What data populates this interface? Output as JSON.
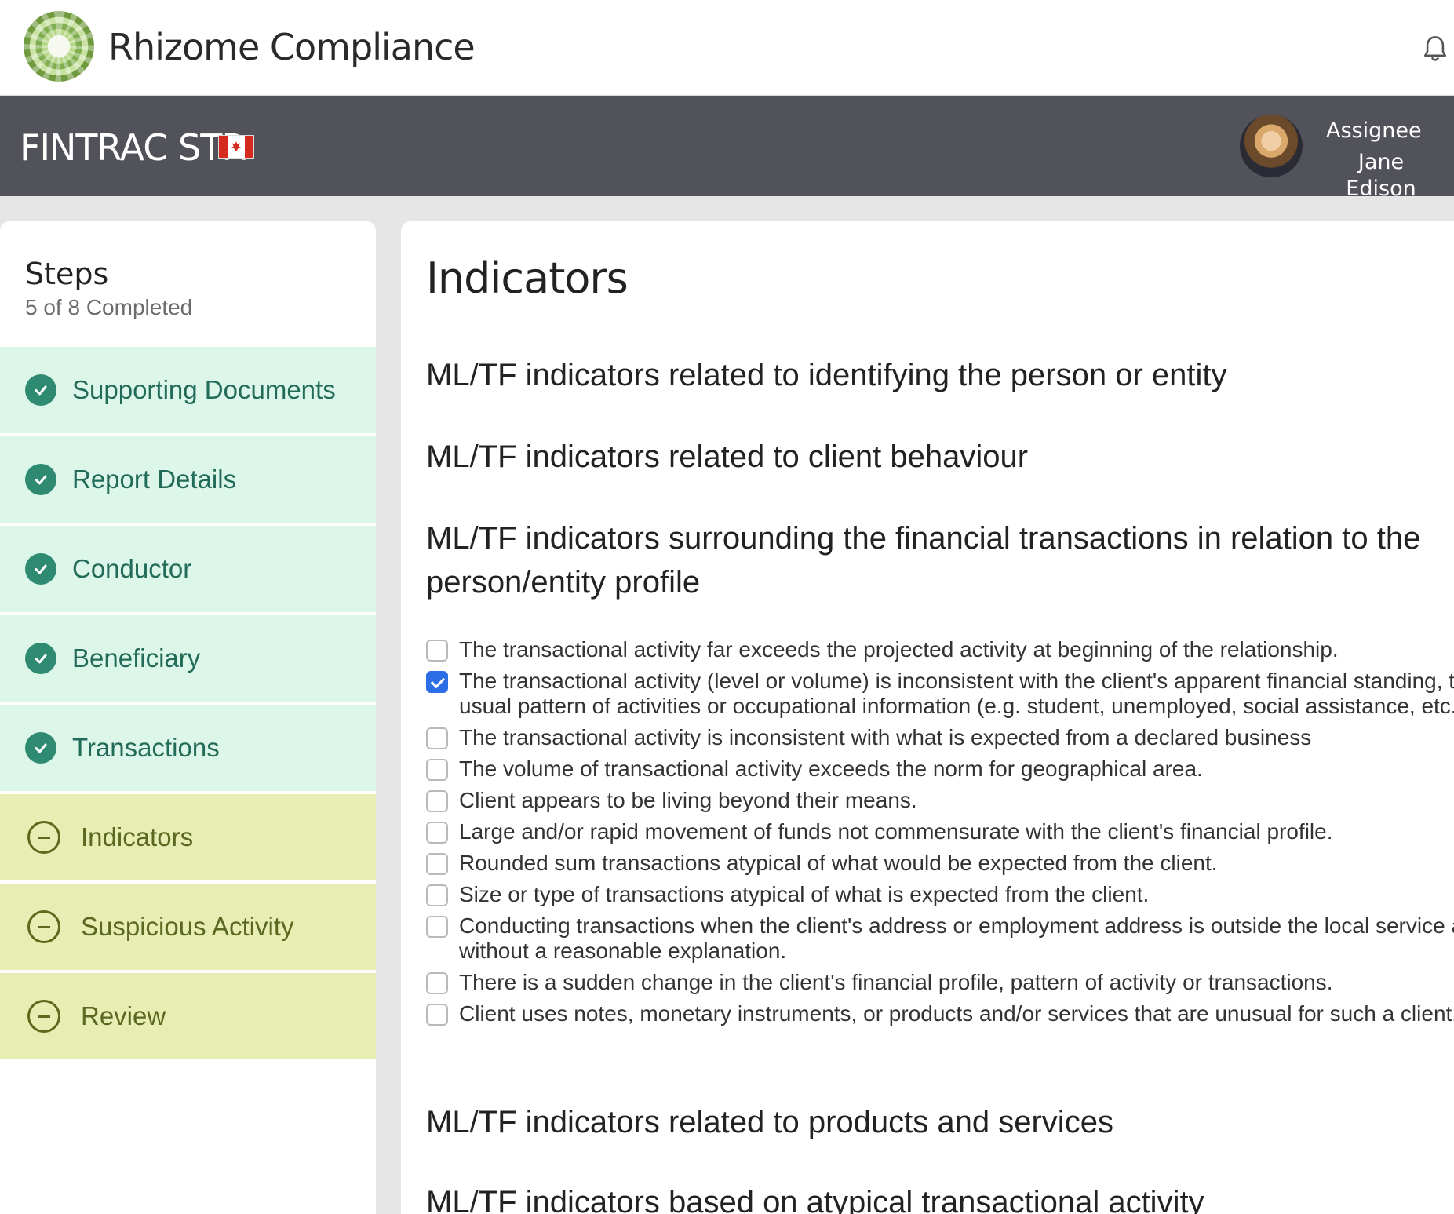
{
  "app": {
    "title": "Rhizome Compliance"
  },
  "header": {
    "form_title": "FINTRAC STR",
    "assignee_label": "Assignee",
    "assignee_name": "Jane Edison"
  },
  "sidebar": {
    "title": "Steps",
    "progress": "5 of 8 Completed",
    "items": [
      {
        "label": "Supporting Documents",
        "status": "completed"
      },
      {
        "label": "Report Details",
        "status": "completed"
      },
      {
        "label": "Conductor",
        "status": "completed"
      },
      {
        "label": "Beneficiary",
        "status": "completed"
      },
      {
        "label": "Transactions",
        "status": "completed"
      },
      {
        "label": "Indicators",
        "status": "pending"
      },
      {
        "label": "Suspicious Activity",
        "status": "pending"
      },
      {
        "label": "Review",
        "status": "pending"
      }
    ]
  },
  "main": {
    "title": "Indicators",
    "sections": [
      "ML/TF indicators related to identifying the person or entity",
      "ML/TF indicators related to client behaviour",
      "ML/TF indicators surrounding the financial transactions in relation to the person/entity profile",
      "ML/TF indicators related to products and services",
      "ML/TF indicators based on atypical transactional activity"
    ],
    "indicators": [
      {
        "text": "The transactional activity far exceeds the projected activity at beginning of the relationship.",
        "checked": false
      },
      {
        "text": "The transactional activity (level or volume) is inconsistent with the client's apparent financial standing, their usual pattern of activities or occupational information (e.g. student, unemployed, social assistance, etc.).",
        "checked": true
      },
      {
        "text": "The transactional activity is inconsistent with what is expected from a declared business",
        "checked": false
      },
      {
        "text": "The volume of transactional activity exceeds the norm for geographical area.",
        "checked": false
      },
      {
        "text": "Client appears to be living beyond their means.",
        "checked": false
      },
      {
        "text": "Large and/or rapid movement of funds not commensurate with the client's financial profile.",
        "checked": false
      },
      {
        "text": "Rounded sum transactions atypical of what would be expected from the client.",
        "checked": false
      },
      {
        "text": "Size or type of transactions atypical of what is expected from the client.",
        "checked": false
      },
      {
        "text": "Conducting transactions when the client's address or employment address is outside the local service area without a reasonable explanation.",
        "checked": false
      },
      {
        "text": "There is a sudden change in the client's financial profile, pattern of activity or transactions.",
        "checked": false
      },
      {
        "text": "Client uses notes, monetary instruments, or products and/or services that are unusual for such a client.",
        "checked": false
      }
    ]
  },
  "colors": {
    "banner": "#51525a",
    "completed_bg": "#dcf7ea",
    "pending_bg": "#e7edb3",
    "accent": "#2f8a72",
    "checkbox_checked": "#2c6ee6"
  },
  "icons": {
    "logo": "rhizome-logo",
    "notifications": "bell-icon",
    "flag": "canada-flag-icon",
    "completed": "check-circle-icon",
    "pending": "minus-circle-icon"
  }
}
